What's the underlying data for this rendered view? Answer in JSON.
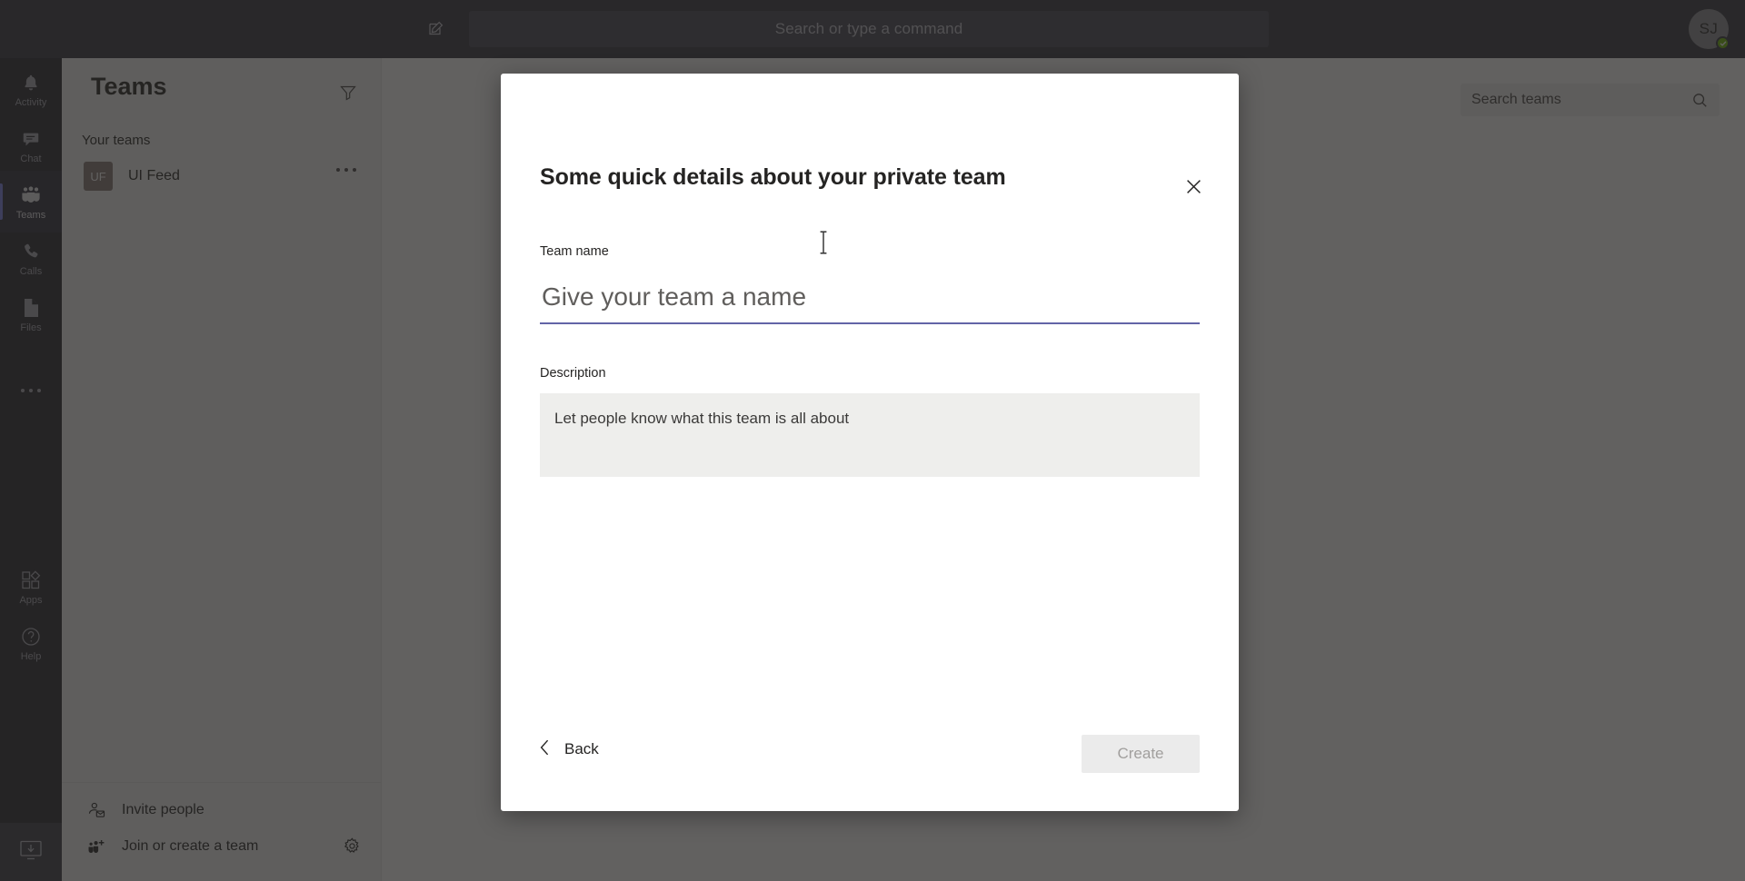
{
  "titlebar": {
    "compose_icon": "compose-icon",
    "search": {
      "placeholder": "Search or type a command",
      "value": ""
    },
    "avatar": {
      "initials": "SJ",
      "presence": "available",
      "presence_color": "#6bb700"
    }
  },
  "rail": {
    "items": [
      {
        "label": "Activity",
        "icon": "bell-icon",
        "active": false
      },
      {
        "label": "Chat",
        "icon": "chat-icon",
        "active": false
      },
      {
        "label": "Teams",
        "icon": "teams-icon",
        "active": true
      },
      {
        "label": "Calls",
        "icon": "phone-icon",
        "active": false
      },
      {
        "label": "Files",
        "icon": "file-icon",
        "active": false
      }
    ],
    "more_label": "...",
    "apps": {
      "label": "Apps",
      "icon": "apps-icon"
    },
    "help": {
      "label": "Help",
      "icon": "help-icon"
    },
    "download": {
      "icon": "download-app-icon"
    }
  },
  "pane": {
    "title": "Teams",
    "filter_icon": "filter-icon",
    "section_label": "Your teams",
    "team": {
      "initials": "UF",
      "name": "UI Feed",
      "avatar_color": "#8a7a77",
      "overflow_icon": "more-options-icon"
    },
    "footer": {
      "invite_label": "Invite people",
      "invite_icon": "invite-person-icon",
      "join_label": "Join or create a team",
      "join_icon": "add-team-icon",
      "settings_icon": "gear-icon"
    }
  },
  "content": {
    "search_teams": {
      "placeholder": "Search teams",
      "value": "",
      "icon": "search-icon"
    }
  },
  "modal": {
    "title": "Some quick details about your private team",
    "close_icon": "close-icon",
    "team_name": {
      "label": "Team name",
      "placeholder": "Give your team a name",
      "value": ""
    },
    "description": {
      "label": "Description",
      "placeholder": "Let people know what this team is all about",
      "value": ""
    },
    "back_label": "Back",
    "back_icon": "chevron-left-icon",
    "create_label": "Create",
    "create_enabled": false,
    "accent_color": "#6264a7"
  }
}
